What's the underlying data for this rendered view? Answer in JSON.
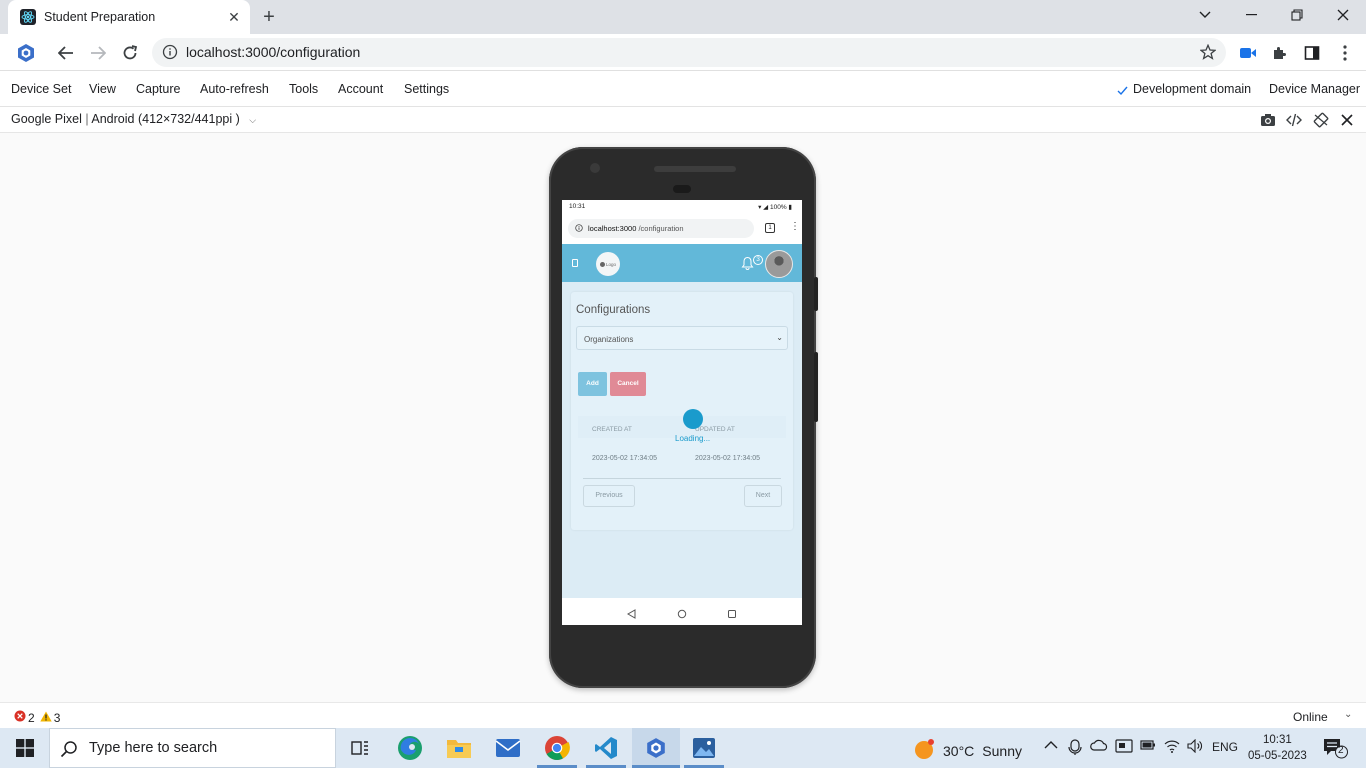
{
  "browser": {
    "tab_title": "Student Preparation",
    "url": "localhost:3000/configuration"
  },
  "menubar": {
    "items": [
      "Device Set",
      "View",
      "Capture",
      "Auto-refresh",
      "Tools",
      "Account",
      "Settings"
    ],
    "dev_domain": "Development domain",
    "device_manager": "Device Manager"
  },
  "devbar": {
    "device_name": "Google Pixel",
    "device_spec": "Android (412×732/441ppi )"
  },
  "phone": {
    "status_time": "10:31",
    "status_battery": "100%",
    "url_host": "localhost:3000",
    "url_path": " /configuration",
    "logo_text": "Logo",
    "notification_count": "3",
    "page_title": "Configurations",
    "select_value": "Organizations",
    "add_label": "Add",
    "cancel_label": "Cancel",
    "col_created": "CREATED AT",
    "col_updated": "UPDATED AT",
    "row_created": "2023-05-02 17:34:05",
    "row_updated": "2023-05-02 17:34:05",
    "loading": "Loading...",
    "prev_label": "Previous",
    "next_label": "Next"
  },
  "statusline": {
    "errors": "2",
    "warnings": "3",
    "network": "Online"
  },
  "taskbar": {
    "search_placeholder": "Type here to search",
    "temperature": "30°C",
    "weather": "Sunny",
    "language": "ENG",
    "time": "10:31",
    "date": "05-05-2023",
    "notifications": "2"
  },
  "colors": {
    "app_bar": "#62b8d9",
    "add_button": "#7ec3df",
    "cancel_button": "#e08a96",
    "spinner": "#1a9bcc"
  }
}
